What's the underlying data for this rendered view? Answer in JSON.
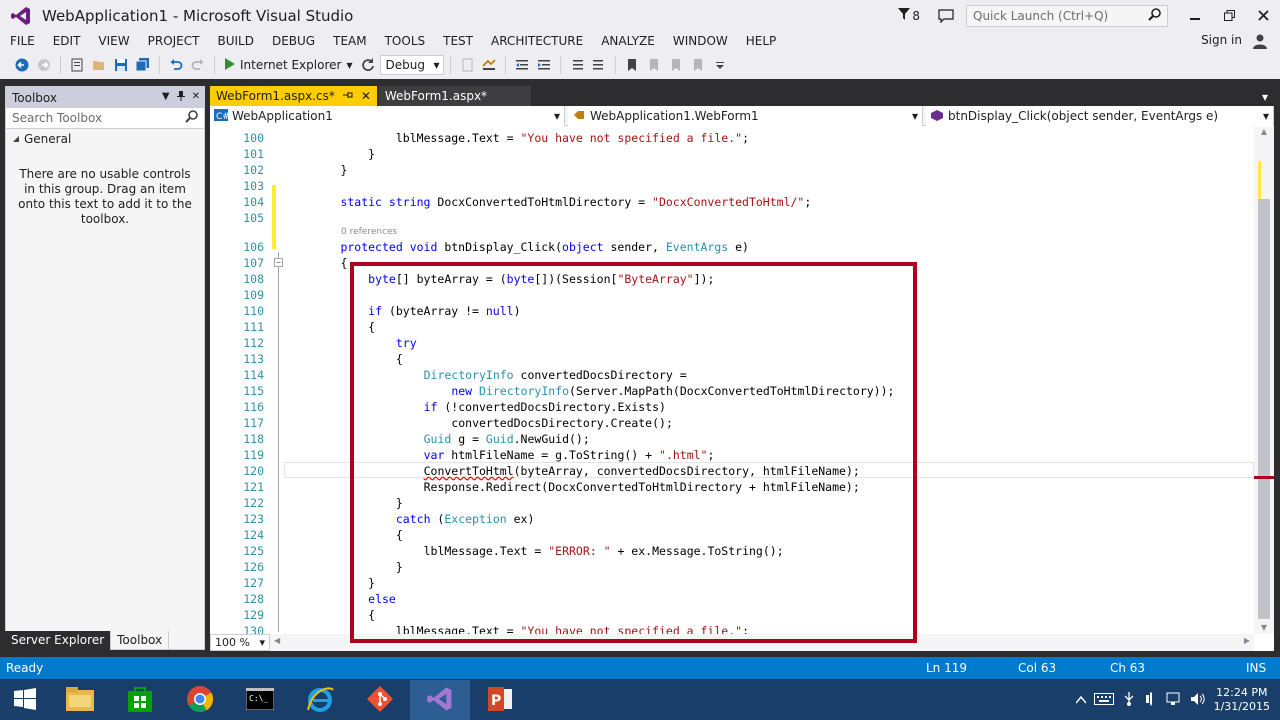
{
  "window": {
    "title": "WebApplication1 - Microsoft Visual Studio",
    "notifications_count": "8",
    "quick_launch_placeholder": "Quick Launch (Ctrl+Q)",
    "sign_in": "Sign in"
  },
  "menu": [
    "FILE",
    "EDIT",
    "VIEW",
    "PROJECT",
    "BUILD",
    "DEBUG",
    "TEAM",
    "TOOLS",
    "TEST",
    "ARCHITECTURE",
    "ANALYZE",
    "WINDOW",
    "HELP"
  ],
  "toolbar": {
    "run_label": "Internet Explorer",
    "config": "Debug"
  },
  "toolbox": {
    "title": "Toolbox",
    "search_placeholder": "Search Toolbox",
    "group": "General",
    "empty_message": "There are no usable controls in this group. Drag an item onto this text to add it to the toolbox.",
    "tabs": [
      "Server Explorer",
      "Toolbox"
    ]
  },
  "doc_tabs": [
    {
      "label": "WebForm1.aspx.cs*",
      "active": true
    },
    {
      "label": "WebForm1.aspx*",
      "active": false
    }
  ],
  "navbar": {
    "project": "WebApplication1",
    "class": "WebApplication1.WebForm1",
    "member": "btnDisplay_Click(object sender, EventArgs e)"
  },
  "code_lines": [
    {
      "n": "100",
      "indent": 16,
      "parts": [
        [
          "",
          "lblMessage.Text = "
        ],
        [
          "str",
          "\"You have not specified a file.\""
        ],
        [
          "",
          ";"
        ]
      ]
    },
    {
      "n": "101",
      "indent": 12,
      "parts": [
        [
          "",
          "}"
        ]
      ]
    },
    {
      "n": "102",
      "indent": 8,
      "parts": [
        [
          "",
          "}"
        ]
      ]
    },
    {
      "n": "103",
      "indent": 0,
      "parts": []
    },
    {
      "n": "104",
      "indent": 8,
      "parts": [
        [
          "kw",
          "static"
        ],
        [
          "",
          " "
        ],
        [
          "kw",
          "string"
        ],
        [
          "",
          " DocxConvertedToHtmlDirectory = "
        ],
        [
          "str",
          "\"DocxConvertedToHtml/\""
        ],
        [
          "",
          ";"
        ]
      ]
    },
    {
      "n": "105",
      "indent": 0,
      "parts": []
    },
    {
      "n": "106",
      "indent": 8,
      "parts": [
        [
          "kw",
          "protected"
        ],
        [
          "",
          " "
        ],
        [
          "kw",
          "void"
        ],
        [
          "",
          " btnDisplay_Click("
        ],
        [
          "kw",
          "object"
        ],
        [
          "",
          " sender, "
        ],
        [
          "typ",
          "EventArgs"
        ],
        [
          "",
          " e)"
        ]
      ]
    },
    {
      "n": "107",
      "indent": 8,
      "parts": [
        [
          "",
          "{"
        ]
      ]
    },
    {
      "n": "108",
      "indent": 12,
      "parts": [
        [
          "kw",
          "byte"
        ],
        [
          "",
          "[] byteArray = ("
        ],
        [
          "kw",
          "byte"
        ],
        [
          "",
          "[])(Session["
        ],
        [
          "str",
          "\"ByteArray\""
        ],
        [
          "",
          "]);"
        ]
      ]
    },
    {
      "n": "109",
      "indent": 0,
      "parts": []
    },
    {
      "n": "110",
      "indent": 12,
      "parts": [
        [
          "kw",
          "if"
        ],
        [
          "",
          " (byteArray != "
        ],
        [
          "kw",
          "null"
        ],
        [
          "",
          ")"
        ]
      ]
    },
    {
      "n": "111",
      "indent": 12,
      "parts": [
        [
          "",
          "{"
        ]
      ]
    },
    {
      "n": "112",
      "indent": 16,
      "parts": [
        [
          "kw",
          "try"
        ]
      ]
    },
    {
      "n": "113",
      "indent": 16,
      "parts": [
        [
          "",
          "{"
        ]
      ]
    },
    {
      "n": "114",
      "indent": 20,
      "parts": [
        [
          "typ",
          "DirectoryInfo"
        ],
        [
          "",
          " convertedDocsDirectory ="
        ]
      ]
    },
    {
      "n": "115",
      "indent": 24,
      "parts": [
        [
          "kw",
          "new"
        ],
        [
          "",
          " "
        ],
        [
          "typ",
          "DirectoryInfo"
        ],
        [
          "",
          "(Server.MapPath(DocxConvertedToHtmlDirectory));"
        ]
      ]
    },
    {
      "n": "116",
      "indent": 20,
      "parts": [
        [
          "kw",
          "if"
        ],
        [
          "",
          " (!convertedDocsDirectory.Exists)"
        ]
      ]
    },
    {
      "n": "117",
      "indent": 24,
      "parts": [
        [
          "",
          "convertedDocsDirectory.Create();"
        ]
      ]
    },
    {
      "n": "118",
      "indent": 20,
      "parts": [
        [
          "typ",
          "Guid"
        ],
        [
          "",
          " g = "
        ],
        [
          "typ",
          "Guid"
        ],
        [
          "",
          ".NewGuid();"
        ]
      ]
    },
    {
      "n": "119",
      "indent": 20,
      "parts": [
        [
          "kw",
          "var"
        ],
        [
          "",
          " htmlFileName = g.ToString() + "
        ],
        [
          "str",
          "\".html\""
        ],
        [
          "",
          ";"
        ]
      ]
    },
    {
      "n": "120",
      "indent": 20,
      "parts": [
        [
          "squig",
          "ConvertToHtml"
        ],
        [
          "",
          "(byteArray, convertedDocsDirectory, htmlFileName);"
        ]
      ]
    },
    {
      "n": "121",
      "indent": 20,
      "parts": [
        [
          "",
          "Response.Redirect(DocxConvertedToHtmlDirectory + htmlFileName);"
        ]
      ]
    },
    {
      "n": "122",
      "indent": 16,
      "parts": [
        [
          "",
          "}"
        ]
      ]
    },
    {
      "n": "123",
      "indent": 16,
      "parts": [
        [
          "kw",
          "catch"
        ],
        [
          "",
          " ("
        ],
        [
          "typ",
          "Exception"
        ],
        [
          "",
          " ex)"
        ]
      ]
    },
    {
      "n": "124",
      "indent": 16,
      "parts": [
        [
          "",
          "{"
        ]
      ]
    },
    {
      "n": "125",
      "indent": 20,
      "parts": [
        [
          "",
          "lblMessage.Text = "
        ],
        [
          "str",
          "\"ERROR: \""
        ],
        [
          "",
          " + ex.Message.ToString();"
        ]
      ]
    },
    {
      "n": "126",
      "indent": 16,
      "parts": [
        [
          "",
          "}"
        ]
      ]
    },
    {
      "n": "127",
      "indent": 12,
      "parts": [
        [
          "",
          "}"
        ]
      ]
    },
    {
      "n": "128",
      "indent": 12,
      "parts": [
        [
          "kw",
          "else"
        ]
      ]
    },
    {
      "n": "129",
      "indent": 12,
      "parts": [
        [
          "",
          "{"
        ]
      ]
    },
    {
      "n": "130",
      "indent": 16,
      "parts": [
        [
          "",
          "lblMessage.Text = "
        ],
        [
          "str",
          "\"You have not specified a file.\""
        ],
        [
          "",
          ";"
        ]
      ]
    }
  ],
  "codelens": "0 references",
  "zoom": "100 %",
  "status": {
    "state": "Ready",
    "ln": "Ln 119",
    "col": "Col 63",
    "ch": "Ch 63",
    "mode": "INS"
  },
  "clock": {
    "time": "12:24 PM",
    "date": "1/31/2015"
  },
  "colors": {
    "accent": "#007acc",
    "active_tab": "#ffcc00",
    "highlight_box": "#b00020"
  }
}
